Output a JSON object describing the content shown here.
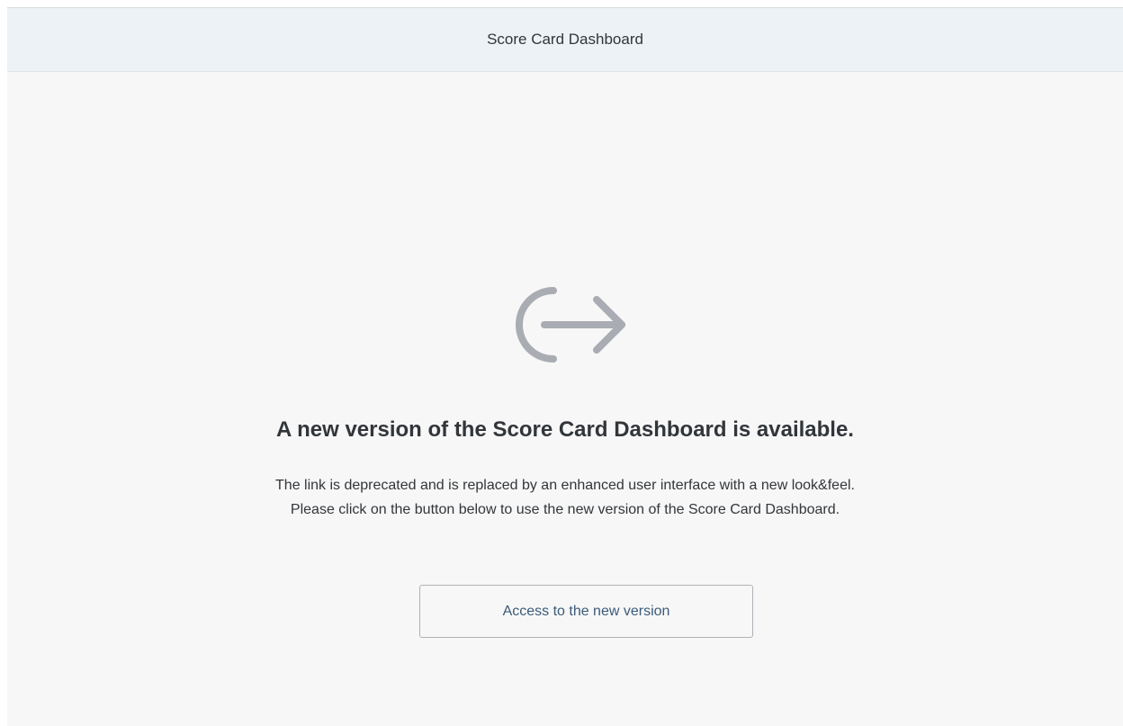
{
  "header": {
    "title": "Score Card Dashboard"
  },
  "notice": {
    "icon": "exit-arrow-icon",
    "icon_color": "#a9acb3",
    "headline": "A new version of the Score Card Dashboard is available.",
    "description_line1": "The link is deprecated and is replaced by an enhanced user interface with a new look&feel.",
    "description_line2": "Please click on the button below to use the new version of the Score Card Dashboard.",
    "button_label": "Access to the new version"
  }
}
